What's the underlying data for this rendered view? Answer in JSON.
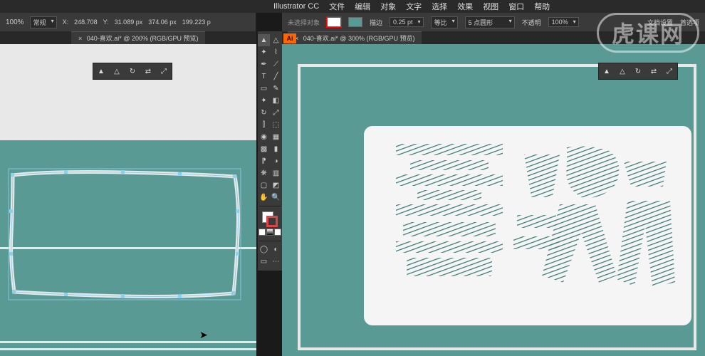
{
  "menubar": {
    "app": "Illustrator CC",
    "items": [
      "文件",
      "编辑",
      "对象",
      "文字",
      "选择",
      "效果",
      "视图",
      "窗口",
      "帮助"
    ]
  },
  "optionsbar": {
    "noselect": "未选择对象",
    "stroke_label": "描边",
    "stroke_weight": "0.25 pt",
    "uniform": "等比",
    "style": "5 点圆形",
    "opacity_label": "不透明",
    "opacity": "100%",
    "docsettings": "文档设置",
    "prefs": "首选项"
  },
  "optionsbar_left": {
    "zoom": "100%",
    "menu1": "常规",
    "x": "248.708",
    "y": "31.089 px",
    "w": "374.06 px",
    "h": "199.223 p"
  },
  "tabs": {
    "left": "040-喜欢.ai* @ 200% (RGB/GPU 预览)",
    "right": "040-喜欢.ai* @ 300% (RGB/GPU 预览)"
  },
  "ai_badge": "Ai",
  "watermark": "虎课网",
  "colors": {
    "teal": "#5a9a94",
    "canvas": "#e8e8e8"
  },
  "tools": {
    "float": [
      "select",
      "direct",
      "rotate",
      "reflect",
      "scale"
    ]
  }
}
